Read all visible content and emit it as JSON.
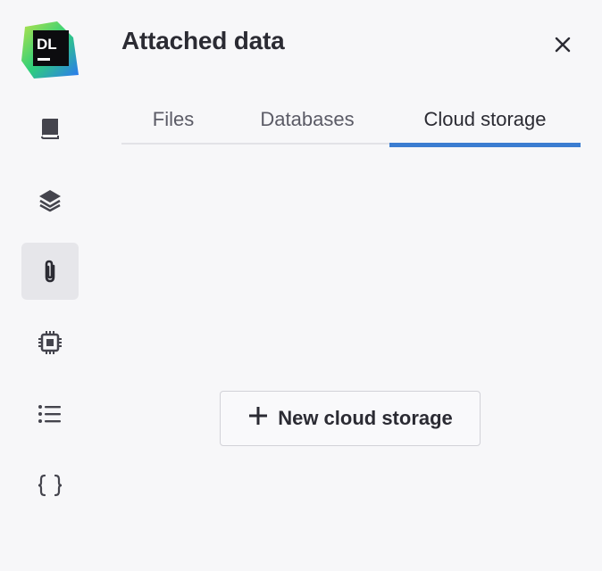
{
  "app": {
    "logo_text": "DL"
  },
  "header": {
    "title": "Attached data"
  },
  "tabs": [
    {
      "label": "Files",
      "active": false
    },
    {
      "label": "Databases",
      "active": false
    },
    {
      "label": "Cloud storage",
      "active": true
    }
  ],
  "main": {
    "new_button_label": "New cloud storage"
  },
  "sidebar": {
    "items": [
      {
        "icon": "notebook-icon",
        "active": false
      },
      {
        "icon": "layers-icon",
        "active": false
      },
      {
        "icon": "paperclip-icon",
        "active": true
      },
      {
        "icon": "chip-icon",
        "active": false
      },
      {
        "icon": "list-icon",
        "active": false
      },
      {
        "icon": "braces-icon",
        "active": false
      }
    ]
  },
  "colors": {
    "accent": "#3b7dd1",
    "background": "#f7f7f9",
    "text": "#2b2b33"
  }
}
